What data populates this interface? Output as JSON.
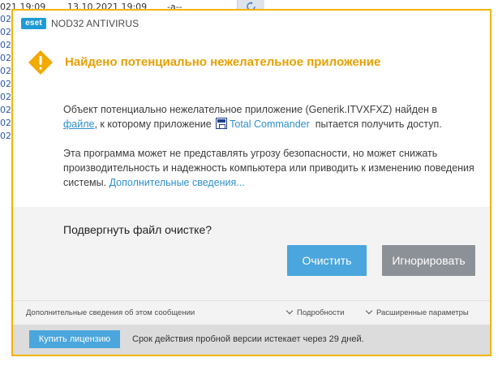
{
  "background": {
    "row_text": [
      "021 19:09",
      "13.10.2021 19:09",
      "-a--"
    ],
    "left_prefix": "02"
  },
  "dialog": {
    "logo_text": "eset",
    "app_title": "NOD32 ANTIVIRUS",
    "heading": "Найдено потенциально нежелательное приложение",
    "para1": {
      "prefix": "Объект потенциально нежелательное приложение (Generik.ITVXFXZ) найден в",
      "file_link": "файле",
      "middle": ", к которому приложение",
      "app_name": "Total Commander",
      "suffix": "пытается получить доступ."
    },
    "para2": {
      "text": "Эта программа может не представлять угрозу безопасности, но может снижать производительность и надежность компьютера или приводить к изменению поведения системы.",
      "more_link": "Дополнительные сведения..."
    },
    "question": "Подвергнуть файл очистке?",
    "buttons": {
      "clean": "Очистить",
      "ignore": "Игнорировать"
    },
    "footer": {
      "info_link": "Дополнительные сведения об этом сообщении",
      "details": "Подробности",
      "advanced": "Расширенные параметры"
    },
    "bottom": {
      "buy_button": "Купить лицензию",
      "trial_text": "Срок действия пробной версии истекает через 29 дней."
    }
  },
  "colors": {
    "accent_border": "#f2b400",
    "heading": "#e8a000",
    "link": "#2f8fcf",
    "primary_button": "#4aa6dc",
    "secondary_button": "#8c9197"
  }
}
